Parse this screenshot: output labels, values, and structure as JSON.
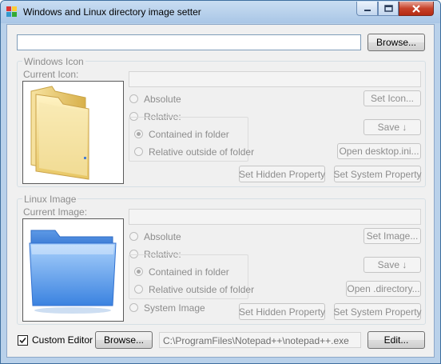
{
  "window": {
    "title": "Windows and Linux directory image setter"
  },
  "top": {
    "path_value": "",
    "browse_label": "Browse..."
  },
  "windows": {
    "group_title": "Windows Icon",
    "current_label": "Current Icon:",
    "path_value": "",
    "absolute_label": "Absolute",
    "relative_label": "Relative:",
    "contained_label": "Contained in folder",
    "outside_label": "Relative outside of folder",
    "set_icon_label": "Set Icon...",
    "save_label": "Save ↓",
    "open_label": "Open desktop.ini...",
    "hidden_label": "Set Hidden Property",
    "system_label": "Set System Property"
  },
  "linux": {
    "group_title": "Linux Image",
    "current_label": "Current Image:",
    "path_value": "",
    "absolute_label": "Absolute",
    "relative_label": "Relative:",
    "contained_label": "Contained in folder",
    "outside_label": "Relative outside of folder",
    "system_image_label": "System Image",
    "set_image_label": "Set Image...",
    "save_label": "Save ↓",
    "open_label": "Open .directory...",
    "hidden_label": "Set Hidden Property",
    "system_label": "Set System Property"
  },
  "bottom": {
    "custom_editor_label": "Custom Editor",
    "custom_editor_checked": true,
    "browse_label": "Browse...",
    "editor_path": "C:\\ProgramFiles\\Notepad++\\notepad++.exe",
    "edit_label": "Edit..."
  },
  "icons": {
    "app": "app-icon",
    "windows_folder": "windows-folder-icon",
    "linux_folder": "linux-folder-icon"
  }
}
